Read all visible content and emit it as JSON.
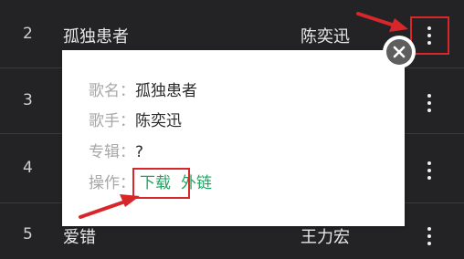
{
  "song_list": [
    {
      "number": "2",
      "title": "孤独患者",
      "artist": "陈奕迅"
    },
    {
      "number": "3",
      "title": "",
      "artist": ""
    },
    {
      "number": "4",
      "title": "",
      "artist": ""
    },
    {
      "number": "5",
      "title": "爱错",
      "artist": "王力宏"
    }
  ],
  "popup": {
    "song_label": "歌名：",
    "song_value": "孤独患者",
    "artist_label": "歌手：",
    "artist_value": "陈奕迅",
    "album_label": "专辑：",
    "album_value": "?",
    "actions_label": "操作：",
    "download_label": "下载",
    "external_link_label": "外链"
  },
  "icons": {
    "more": "more-vertical-icon",
    "close": "close-icon"
  },
  "colors": {
    "background": "#232326",
    "annotation_red": "#d7272a",
    "link_green": "#1fa362",
    "card_background": "#ffffff"
  }
}
